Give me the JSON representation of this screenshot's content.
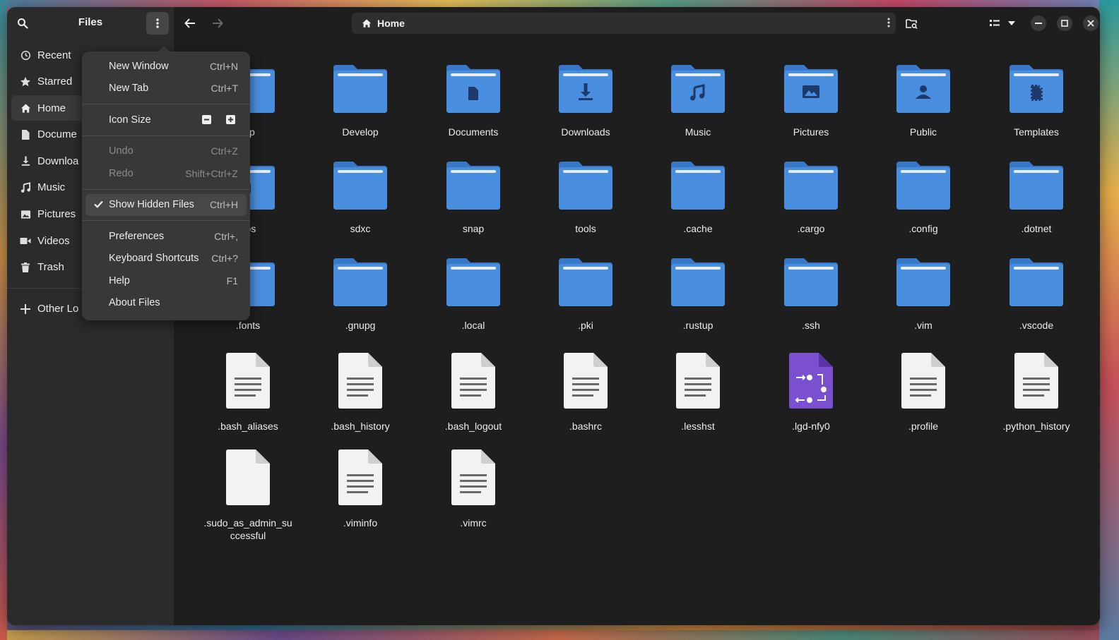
{
  "window": {
    "sidebar_title": "Files",
    "path": "Home"
  },
  "sidebar": {
    "items": [
      {
        "label": "Recent",
        "icon": "clock-icon"
      },
      {
        "label": "Starred",
        "icon": "star-icon"
      },
      {
        "label": "Home",
        "icon": "home-icon",
        "selected": true
      },
      {
        "label": "Docume",
        "icon": "document-icon"
      },
      {
        "label": "Downloa",
        "icon": "download-icon"
      },
      {
        "label": "Music",
        "icon": "music-icon"
      },
      {
        "label": "Pictures",
        "icon": "image-icon"
      },
      {
        "label": "Videos",
        "icon": "video-icon"
      },
      {
        "label": "Trash",
        "icon": "trash-icon"
      }
    ],
    "other_locations": "Other Lo"
  },
  "menu": {
    "items": [
      {
        "label": "New Window",
        "accel": "Ctrl+N"
      },
      {
        "label": "New Tab",
        "accel": "Ctrl+T"
      },
      {
        "label": "Icon Size"
      },
      {
        "label": "Undo",
        "accel": "Ctrl+Z",
        "disabled": true
      },
      {
        "label": "Redo",
        "accel": "Shift+Ctrl+Z",
        "disabled": true
      },
      {
        "label": "Show Hidden Files",
        "accel": "Ctrl+H",
        "checked": true
      },
      {
        "label": "Preferences",
        "accel": "Ctrl+,"
      },
      {
        "label": "Keyboard Shortcuts",
        "accel": "Ctrl+?"
      },
      {
        "label": "Help",
        "accel": "F1"
      },
      {
        "label": "About Files"
      }
    ]
  },
  "files": {
    "rows": [
      [
        {
          "name": "top",
          "type": "folder",
          "emblem": "",
          "partial": true
        },
        {
          "name": "Develop",
          "type": "folder",
          "emblem": ""
        },
        {
          "name": "Documents",
          "type": "folder",
          "emblem": "document"
        },
        {
          "name": "Downloads",
          "type": "folder",
          "emblem": "download"
        },
        {
          "name": "Music",
          "type": "folder",
          "emblem": "music"
        },
        {
          "name": "Pictures",
          "type": "folder",
          "emblem": "image"
        },
        {
          "name": "Public",
          "type": "folder",
          "emblem": "person"
        },
        {
          "name": "Templates",
          "type": "folder",
          "emblem": "template"
        }
      ],
      [
        {
          "name": "eos",
          "type": "folder",
          "emblem": "video",
          "partial": true
        },
        {
          "name": "sdxc",
          "type": "folder",
          "emblem": ""
        },
        {
          "name": "snap",
          "type": "folder",
          "emblem": ""
        },
        {
          "name": "tools",
          "type": "folder",
          "emblem": ""
        },
        {
          "name": ".cache",
          "type": "folder",
          "emblem": ""
        },
        {
          "name": ".cargo",
          "type": "folder",
          "emblem": ""
        },
        {
          "name": ".config",
          "type": "folder",
          "emblem": ""
        },
        {
          "name": ".dotnet",
          "type": "folder",
          "emblem": ""
        }
      ],
      [
        {
          "name": ".fonts",
          "type": "folder",
          "emblem": "",
          "partial": true
        },
        {
          "name": ".gnupg",
          "type": "folder",
          "emblem": ""
        },
        {
          "name": ".local",
          "type": "folder",
          "emblem": ""
        },
        {
          "name": ".pki",
          "type": "folder",
          "emblem": ""
        },
        {
          "name": ".rustup",
          "type": "folder",
          "emblem": ""
        },
        {
          "name": ".ssh",
          "type": "folder",
          "emblem": ""
        },
        {
          "name": ".vim",
          "type": "folder",
          "emblem": ""
        },
        {
          "name": ".vscode",
          "type": "folder",
          "emblem": ""
        }
      ],
      [
        {
          "name": ".bash_aliases",
          "type": "text"
        },
        {
          "name": ".bash_history",
          "type": "text"
        },
        {
          "name": ".bash_logout",
          "type": "text"
        },
        {
          "name": ".bashrc",
          "type": "text"
        },
        {
          "name": ".lesshst",
          "type": "text"
        },
        {
          "name": ".lgd-nfy0",
          "type": "purple"
        },
        {
          "name": ".profile",
          "type": "text"
        },
        {
          "name": ".python_history",
          "type": "text"
        }
      ],
      [
        {
          "name": ".sudo_as_admin_su\nccessful",
          "type": "blank"
        },
        {
          "name": ".viminfo",
          "type": "text"
        },
        {
          "name": ".vimrc",
          "type": "text"
        }
      ]
    ]
  },
  "colors": {
    "folder": "#4a8ee0",
    "folder_tab": "#3978c8",
    "purple_file": "#7a4fd0"
  }
}
